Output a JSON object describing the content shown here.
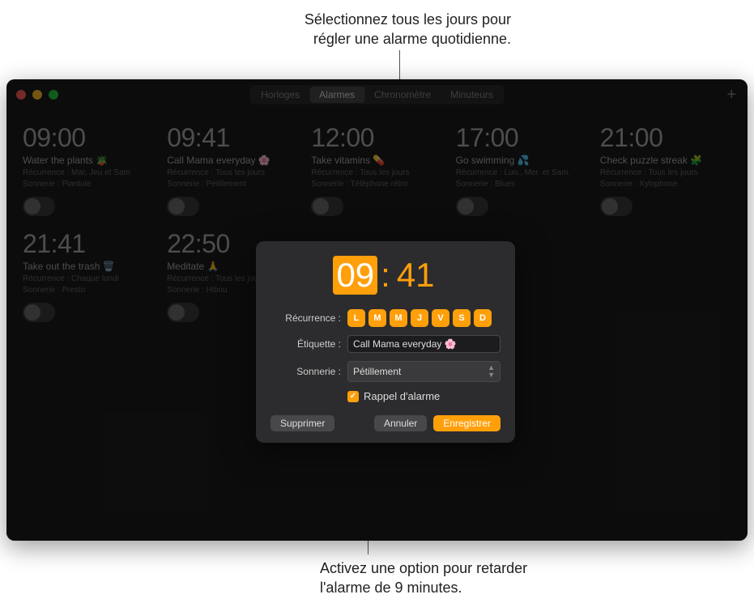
{
  "callouts": {
    "top_line1": "Sélectionnez tous les jours pour",
    "top_line2": "régler une alarme quotidienne.",
    "bottom_line1": "Activez une option pour retarder",
    "bottom_line2": "l'alarme de 9 minutes."
  },
  "titlebar": {
    "tabs": [
      "Horloges",
      "Alarmes",
      "Chronomètre",
      "Minuteurs"
    ],
    "active_tab_index": 1
  },
  "alarms": [
    {
      "time": "09:00",
      "label": "Water the plants 🪴",
      "repeat": "Récurrence : Mar, Jeu et Sam",
      "sound": "Sonnerie : Plantule"
    },
    {
      "time": "09:41",
      "label": "Call Mama everyday 🌸",
      "repeat": "Récurrence : Tous les jours",
      "sound": "Sonnerie : Pétillement"
    },
    {
      "time": "12:00",
      "label": "Take vitamins 💊",
      "repeat": "Récurrence : Tous les jours",
      "sound": "Sonnerie : Téléphone rétro"
    },
    {
      "time": "17:00",
      "label": "Go swimming 💦",
      "repeat": "Récurrence : Lun., Mer. et Sam.",
      "sound": "Sonnerie : Blues"
    },
    {
      "time": "21:00",
      "label": "Check puzzle streak 🧩",
      "repeat": "Récurrence : Tous les jours",
      "sound": "Sonnerie : Xylophone"
    },
    {
      "time": "21:41",
      "label": "Take out the trash 🗑️",
      "repeat": "Récurrence : Chaque lundi",
      "sound": "Sonnerie : Presto"
    },
    {
      "time": "22:50",
      "label": "Meditate 🙏",
      "repeat": "Récurrence : Tous les jours",
      "sound": "Sonnerie : Hibou"
    }
  ],
  "modal": {
    "time_hh": "09",
    "time_mm": "41",
    "repeat_label": "Récurrence :",
    "days": [
      "L",
      "M",
      "M",
      "J",
      "V",
      "S",
      "D"
    ],
    "etiquette_label": "Étiquette :",
    "etiquette_value": "Call Mama everyday 🌸",
    "sonnerie_label": "Sonnerie :",
    "sonnerie_value": "Pétillement",
    "snooze_label": "Rappel d'alarme",
    "delete_btn": "Supprimer",
    "cancel_btn": "Annuler",
    "save_btn": "Enregistrer"
  }
}
